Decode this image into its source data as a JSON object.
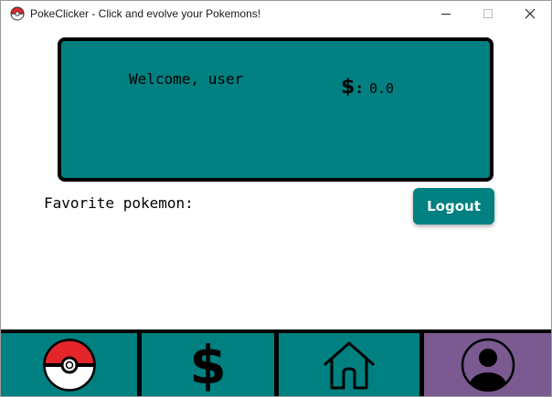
{
  "window": {
    "title": "PokeClicker - Click and evolve your Pokemons!",
    "controls": [
      "minimize",
      "maximize",
      "close"
    ]
  },
  "header": {
    "welcome": "Welcome, user",
    "currency_symbol": "$",
    "currency_separator": ":",
    "balance": "0.0"
  },
  "profile": {
    "favorite_label": "Favorite pokemon:",
    "favorite_value": ""
  },
  "actions": {
    "logout_label": "Logout"
  },
  "navbar": {
    "items": [
      {
        "name": "pokeball",
        "icon": "pokeball-icon",
        "active": false
      },
      {
        "name": "shop",
        "icon": "dollar-icon",
        "label": "$",
        "active": false
      },
      {
        "name": "home",
        "icon": "home-icon",
        "active": false
      },
      {
        "name": "profile",
        "icon": "user-icon",
        "active": true
      }
    ]
  },
  "colors": {
    "teal": "#008080",
    "active_nav": "#7b5a91",
    "border": "#000000",
    "pokeball_red": "#e4262b"
  }
}
